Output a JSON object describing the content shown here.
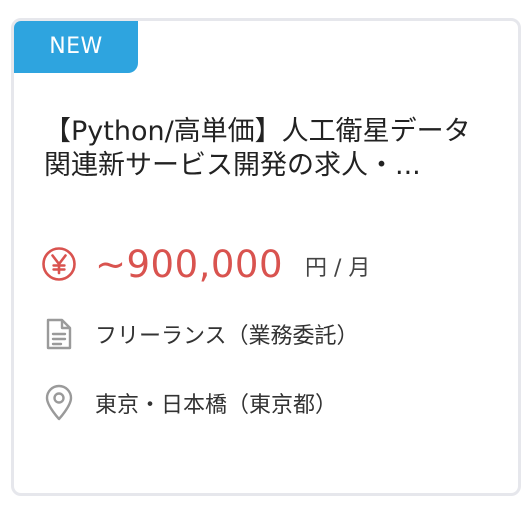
{
  "card": {
    "badge": "NEW",
    "title": "【Python/高単価】人工衛星データ関連新サービス開発の求人・...",
    "price": "~900,000",
    "price_unit": "円 / 月",
    "employment_type": "フリーランス（業務委託）",
    "location": "東京・日本橋（東京都）"
  },
  "icons": {
    "price": "yen-circle-icon",
    "employment_type": "document-icon",
    "location": "map-pin-icon"
  },
  "colors": {
    "badge_bg": "#2ea4df",
    "price": "#d9534f",
    "icon_gray": "#9a9a9a",
    "border": "#e6e7ec"
  }
}
